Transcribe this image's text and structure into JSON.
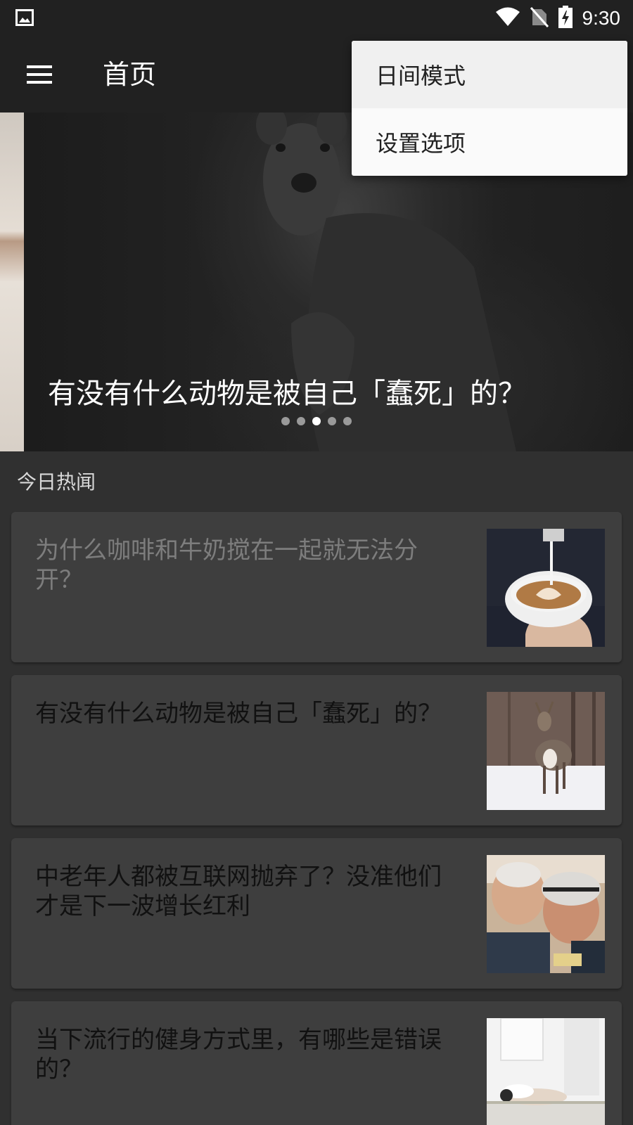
{
  "status_bar": {
    "time": "9:30",
    "icons": [
      "image-notification-icon",
      "wifi-icon",
      "no-sim-icon",
      "battery-charging-icon"
    ]
  },
  "toolbar": {
    "title": "首页",
    "menu_icon": "hamburger-menu-icon"
  },
  "overflow_menu": {
    "items": [
      {
        "label": "日间模式"
      },
      {
        "label": "设置选项"
      }
    ]
  },
  "banner": {
    "title": "有没有什么动物是被自己「蠢死」的？",
    "page_count": 5,
    "active_page": 3
  },
  "section": {
    "header": "今日热闻"
  },
  "stories": [
    {
      "title": "为什么咖啡和牛奶搅在一起就无法分开？",
      "read": true,
      "thumb": "latte-art-photo"
    },
    {
      "title": "有没有什么动物是被自己「蠢死」的？",
      "read": false,
      "thumb": "deer-in-snow-photo"
    },
    {
      "title": "中老年人都被互联网抛弃了？没准他们才是下一波增长红利",
      "read": false,
      "thumb": "elderly-couple-phone-photo"
    },
    {
      "title": "当下流行的健身方式里，有哪些是错误的？",
      "read": false,
      "thumb": "yoga-pose-photo"
    }
  ],
  "colors": {
    "toolbar_bg": "#212121",
    "page_bg": "#303030",
    "card_bg": "#3e3e3e",
    "menu_bg": "#fafafa",
    "read_text": "#7d7d7d"
  }
}
